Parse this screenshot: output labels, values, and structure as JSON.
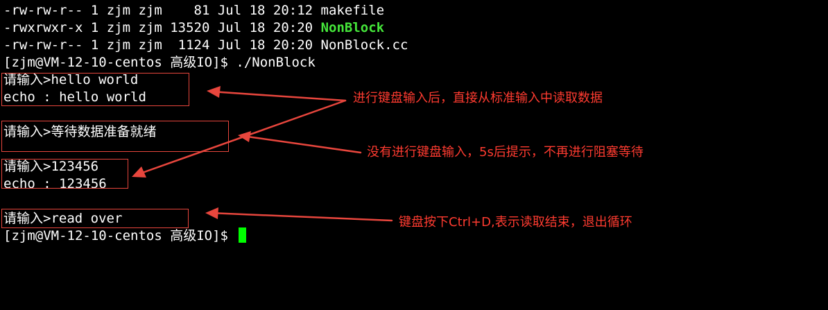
{
  "terminal": {
    "lines": [
      "-rw-rw-r-- 1 zjm zjm    81 Jul 18 20:12 makefile",
      "-rwxrwxr-x 1 zjm zjm 13520 Jul 18 20:20 ",
      "-rw-rw-r-- 1 zjm zjm  1124 Jul 18 20:20 NonBlock.cc",
      "[zjm@VM-12-10-centos 高级IO]$ ./NonBlock",
      "请输入>hello world",
      "echo : hello world",
      "",
      "请输入>等待数据准备就绪",
      "",
      "请输入>123456",
      "echo : 123456",
      "",
      "请输入>read over",
      "[zjm@VM-12-10-centos 高级IO]$ "
    ],
    "executable_name": "NonBlock",
    "executable_color": "#45e63a",
    "cursor_color": "#00ff00"
  },
  "annotations": [
    {
      "text": "进行键盘输入后，直接从标准输入中读取数据"
    },
    {
      "text": "没有进行键盘输入，5s后提示，不再进行阻塞等待"
    },
    {
      "text": "键盘按下Ctrl+D,表示读取结束，退出循环"
    }
  ],
  "annotation_color": "#ff3b30"
}
